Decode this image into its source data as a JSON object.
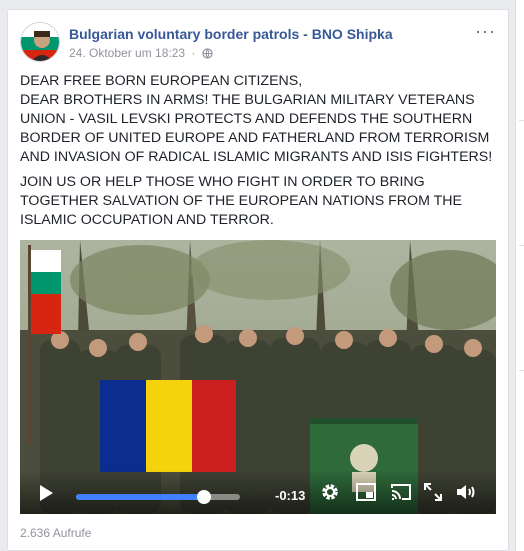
{
  "post": {
    "author": "Bulgarian voluntary border patrols - BNO Shipka",
    "date": "24. Oktober um 18:23",
    "separator": "·",
    "privacy_icon": "globe-icon",
    "more_label": "···",
    "paragraphs": [
      [
        "DEAR FREE BORN EUROPEAN CITIZENS,",
        "DEAR BROTHERS IN ARMS! THE BULGARIAN MILITARY VETERANS",
        "UNION - VASIL LEVSKI PROTECTS AND DEFENDS THE SOUTHERN",
        "BORDER OF UNITED EUROPE AND FATHERLAND FROM TERRORISM",
        "AND INVASION OF RADICAL ISLAMIC MIGRANTS AND ISIS FIGHTERS!"
      ],
      [
        "JOIN US OR HELP THOSE WHO FIGHT IN ORDER TO BRING",
        "TOGETHER SALVATION OF THE EUROPEAN NATIONS FROM THE",
        "ISLAMIC OCCUPATION AND TERROR."
      ]
    ]
  },
  "video": {
    "time_remaining": "-0:13",
    "progress_fraction": 0.78,
    "accent_color": "#4080ff",
    "icons": [
      "play-icon",
      "gear-icon",
      "pip-icon",
      "cast-icon",
      "fullscreen-icon",
      "volume-icon"
    ]
  },
  "footer": {
    "views": "2.636 Aufrufe"
  },
  "colors": {
    "author_link": "#385898",
    "meta_text": "#90949c",
    "body_text": "#1d2129",
    "page_bg": "#e9ebee"
  }
}
